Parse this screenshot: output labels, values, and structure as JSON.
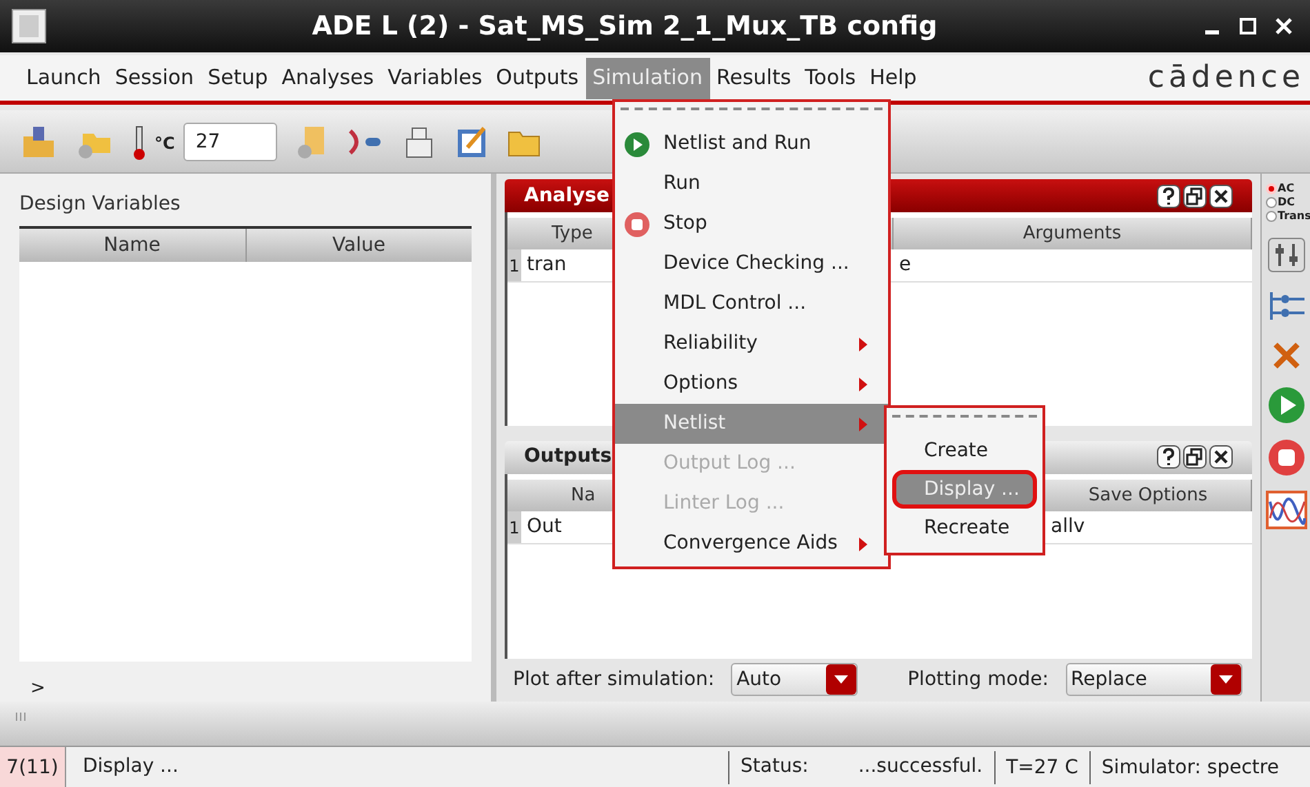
{
  "window": {
    "title": "ADE L (2) - Sat_MS_Sim 2_1_Mux_TB config"
  },
  "menu_bar": {
    "items": [
      {
        "label": "Launch",
        "selected": false
      },
      {
        "label": "Session",
        "selected": false
      },
      {
        "label": "Setup",
        "selected": false
      },
      {
        "label": "Analyses",
        "selected": false
      },
      {
        "label": "Variables",
        "selected": false
      },
      {
        "label": "Outputs",
        "selected": false
      },
      {
        "label": "Simulation",
        "selected": true
      },
      {
        "label": "Results",
        "selected": false
      },
      {
        "label": "Tools",
        "selected": false
      },
      {
        "label": "Help",
        "selected": false
      }
    ],
    "logo": "cādence"
  },
  "toolbar": {
    "temperature_unit": "°C",
    "temperature": "27"
  },
  "design_variables": {
    "title": "Design Variables",
    "columns": [
      "Name",
      "Value"
    ],
    "prompt": ">"
  },
  "analyses_panel": {
    "title": "Analyse",
    "columns": [
      "Type",
      "Arguments"
    ],
    "rows": [
      {
        "index": "1",
        "type": "tran",
        "arguments": "e"
      }
    ]
  },
  "outputs_panel": {
    "title": "Outputs",
    "columns": [
      "Na",
      "Save Options"
    ],
    "rows": [
      {
        "index": "1",
        "name": "Out",
        "save_options": "allv"
      }
    ]
  },
  "plot_controls": {
    "plot_label": "Plot after simulation:",
    "plot_value": "Auto",
    "mode_label": "Plotting mode:",
    "mode_value": "Replace"
  },
  "analysis_types": [
    {
      "label": "AC",
      "selected": true
    },
    {
      "label": "DC",
      "selected": false
    },
    {
      "label": "Trans",
      "selected": false
    }
  ],
  "simulation_menu": [
    {
      "label": "Netlist and Run",
      "kind": "run",
      "disabled": false,
      "selected": false
    },
    {
      "label": "Run",
      "kind": "action",
      "disabled": false,
      "selected": false
    },
    {
      "label": "Stop",
      "kind": "stop",
      "disabled": false,
      "selected": false
    },
    {
      "label": "Device Checking ...",
      "kind": "action",
      "disabled": false,
      "selected": false
    },
    {
      "label": "MDL Control ...",
      "kind": "action",
      "disabled": false,
      "selected": false
    },
    {
      "label": "Reliability",
      "kind": "submenu",
      "disabled": false,
      "selected": false
    },
    {
      "label": "Options",
      "kind": "submenu",
      "disabled": false,
      "selected": false
    },
    {
      "label": "Netlist",
      "kind": "submenu",
      "disabled": false,
      "selected": true
    },
    {
      "label": "Output Log ...",
      "kind": "action",
      "disabled": true,
      "selected": false
    },
    {
      "label": "Linter Log ...",
      "kind": "action",
      "disabled": true,
      "selected": false
    },
    {
      "label": "Convergence Aids",
      "kind": "submenu",
      "disabled": false,
      "selected": false
    }
  ],
  "netlist_submenu": [
    {
      "label": "Create",
      "selected": false,
      "circled": false
    },
    {
      "label": "Display ...",
      "selected": true,
      "circled": true
    },
    {
      "label": "Recreate",
      "selected": false,
      "circled": false
    }
  ],
  "status_bar": {
    "line": "7(11)",
    "message": "Display ...",
    "status_label": "Status:",
    "status": "...successful.",
    "temperature": "T=27 C",
    "simulator": "Simulator: spectre"
  }
}
